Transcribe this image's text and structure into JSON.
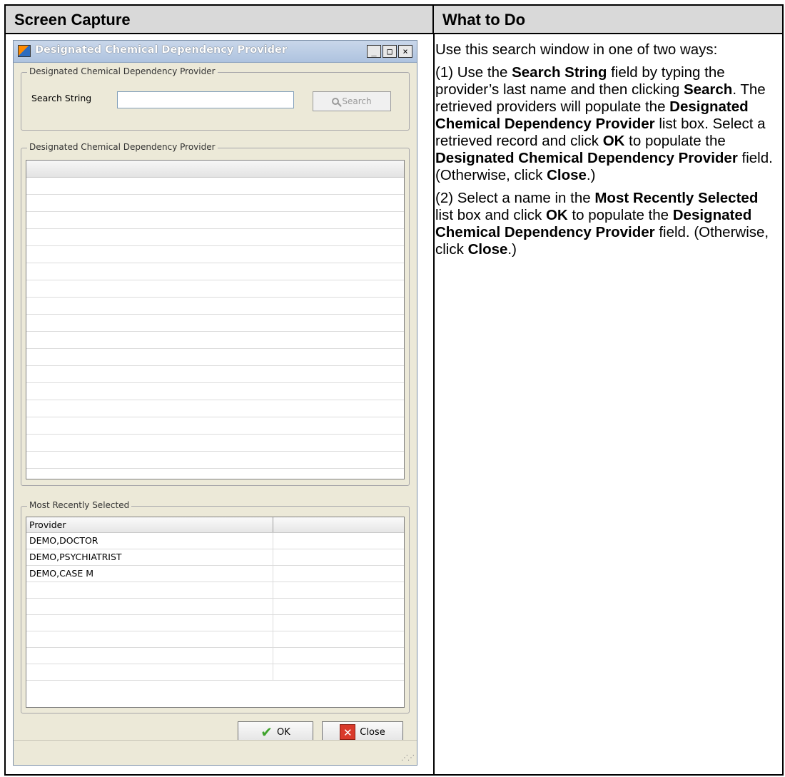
{
  "table": {
    "col_left_header": "Screen Capture",
    "col_right_header": "What to Do"
  },
  "dialog": {
    "title": "Designated Chemical Dependency Provider",
    "window_buttons": [
      "_",
      "□",
      "×"
    ],
    "search_group": {
      "title": "Designated Chemical Dependency Provider",
      "search_label": "Search String",
      "search_value": "",
      "search_button": "Search"
    },
    "results_group": {
      "title": "Designated Chemical Dependency Provider",
      "row_count": 17
    },
    "recent_group": {
      "title": "Most Recently Selected",
      "column_header": "Provider",
      "rows": [
        "DEMO,DOCTOR",
        "DEMO,PSYCHIATRIST",
        "DEMO,CASE M",
        "",
        "",
        "",
        "",
        "",
        ""
      ]
    },
    "ok_button": "OK",
    "close_button": "Close"
  },
  "instructions": {
    "intro": "Use this search window in one of two ways:",
    "step1": {
      "a": "(1) Use the ",
      "b": "Search String",
      "c": " field by typing the provider’s last name and then clicking ",
      "d": "Search",
      "e": ". The retrieved providers will populate the ",
      "f": "Designated Chemical Dependency Provider",
      "g": " list box. Select a retrieved record and click ",
      "h": "OK",
      "i": " to populate the ",
      "j": "Designated Chemical Dependency Provider",
      "k": " field. (Otherwise, click ",
      "l": "Close",
      "m": ".)"
    },
    "step2": {
      "a": "(2) Select a name in the ",
      "b": "Most Recently Selected",
      "c": " list box and click ",
      "d": "OK",
      "e": " to populate the ",
      "f": "Designated Chemical Dependency Provider",
      "g": " field. (Otherwise, click ",
      "h": "Close",
      "i": ".)"
    }
  }
}
